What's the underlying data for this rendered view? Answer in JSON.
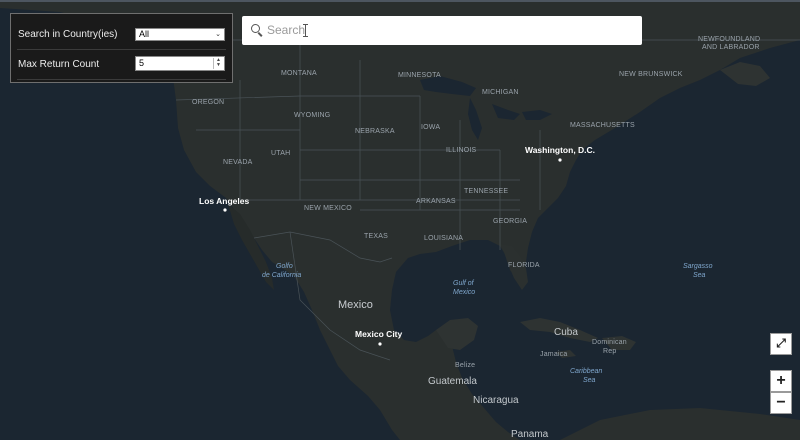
{
  "panel": {
    "country_label": "Search in Country(ies)",
    "country_value": "All",
    "max_label": "Max Return Count",
    "max_value": "5"
  },
  "search": {
    "placeholder": "Search"
  },
  "controls": {
    "fullscreen": "⤢",
    "zoom_in": "+",
    "zoom_out": "−"
  },
  "map": {
    "states": {
      "oregon": "OREGON",
      "montana": "MONTANA",
      "minnesota": "MINNESOTA",
      "wyoming": "WYOMING",
      "michigan": "MICHIGAN",
      "nebraska": "NEBRASKA",
      "iowa": "IOWA",
      "massachusetts": "MASSACHUSETTS",
      "nevada": "NEVADA",
      "utah": "UTAH",
      "illinois": "ILLINOIS",
      "tennessee": "TENNESSEE",
      "arkansas": "ARKANSAS",
      "new_mexico": "NEW MEXICO",
      "georgia": "GEORGIA",
      "texas": "TEXAS",
      "louisiana": "LOUISIANA",
      "florida": "FLORIDA",
      "new_brunswick": "NEW BRUNSWICK",
      "newfoundland_1": "NEWFOUNDLAND",
      "newfoundland_2": "AND LABRADOR"
    },
    "cities": {
      "washington": "Washington, D.C.",
      "los_angeles": "Los Angeles",
      "mexico_city": "Mexico City"
    },
    "countries": {
      "mexico": "Mexico",
      "cuba": "Cuba",
      "jamaica": "Jamaica",
      "dominican_1": "Dominican",
      "dominican_2": "Rep",
      "belize": "Belize",
      "guatemala": "Guatemala",
      "nicaragua": "Nicaragua",
      "panama": "Panama"
    },
    "water": {
      "golfo_1": "Golfo",
      "golfo_2": "de California",
      "gulf_1": "Gulf of",
      "gulf_2": "Mexico",
      "sargasso_1": "Sargasso",
      "sargasso_2": "Sea",
      "caribbean_1": "Caribbean",
      "caribbean_2": "Sea"
    },
    "colors": {
      "ocean": "#1b2631",
      "land": "#2a2f2e",
      "land_dark": "#202624",
      "border": "#4a5358"
    }
  }
}
